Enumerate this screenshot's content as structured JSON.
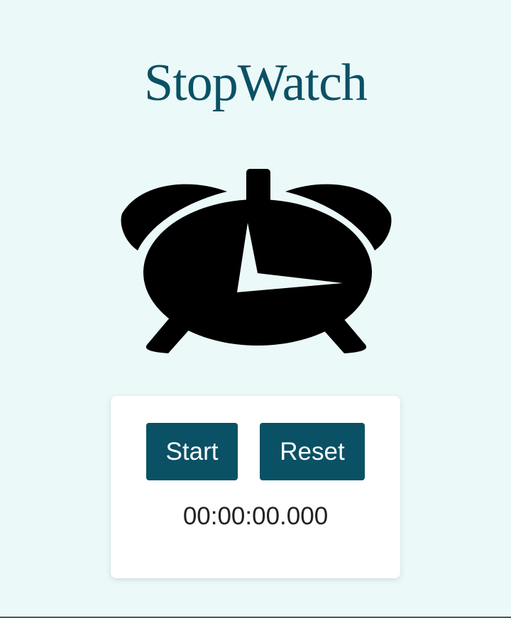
{
  "page": {
    "title": "StopWatch",
    "icon": "alarm-clock-icon"
  },
  "controls": {
    "start_label": "Start",
    "reset_label": "Reset"
  },
  "display": {
    "time": "00:00:00.000"
  },
  "colors": {
    "background": "#ecf9f9",
    "accent": "#0a5165",
    "panel": "#ffffff",
    "clock": "#000000"
  }
}
